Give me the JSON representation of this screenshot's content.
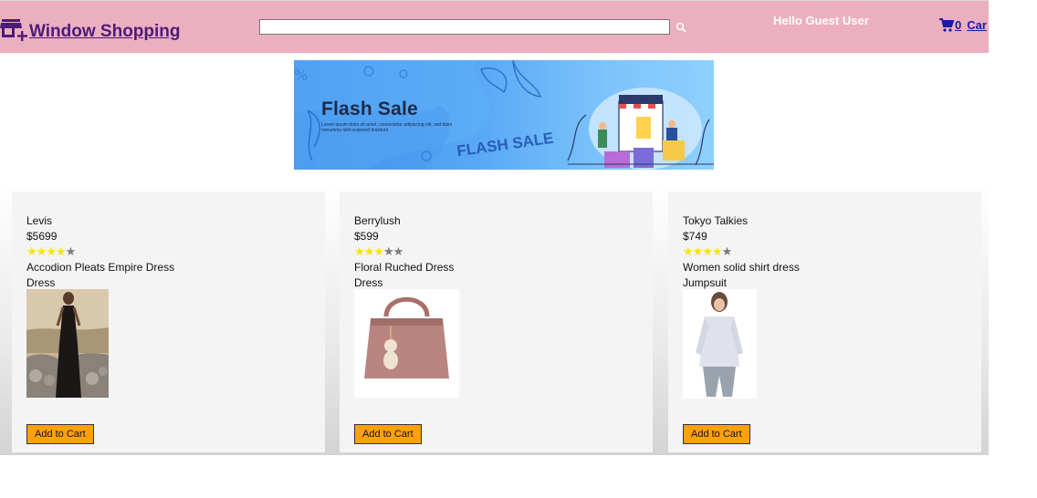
{
  "header": {
    "brand_name": "Window Shopping",
    "brand_icon": "store-plus-icon",
    "search": {
      "value": "",
      "placeholder": ""
    },
    "search_icon": "search-icon",
    "greeting": "Hello Guest User",
    "cart": {
      "icon": "cart-icon",
      "count": "0",
      "label": "Car"
    }
  },
  "banner": {
    "title": "Flash Sale",
    "subtitle": "Lorem ipsum dolor sit amet, consectetur adipiscing elit, sed diam nonummy nibh euismod tincidunt",
    "stamp": "FLASH SALE"
  },
  "products": [
    {
      "brand": "Levis",
      "price": "$5699",
      "rating": 4,
      "rating_max": 5,
      "title": "Accodion Pleats Empire Dress",
      "category": "Dress",
      "add_label": "Add to Cart"
    },
    {
      "brand": "Berrylush",
      "price": "$599",
      "rating": 3,
      "rating_max": 5,
      "title": "Floral Ruched Dress",
      "category": "Dress",
      "add_label": "Add to Cart"
    },
    {
      "brand": "Tokyo Talkies",
      "price": "$749",
      "rating": 4,
      "rating_max": 5,
      "title": "Women solid shirt dress",
      "category": "Jumpsuit",
      "add_label": "Add to Cart"
    }
  ],
  "colors": {
    "navbar": "#ecafbf",
    "brand": "#4d1a7a",
    "cart_link": "#1a1aa6",
    "button": "#ffa10a",
    "star_on": "#f5e50a",
    "star_off": "#7a7a7a"
  }
}
